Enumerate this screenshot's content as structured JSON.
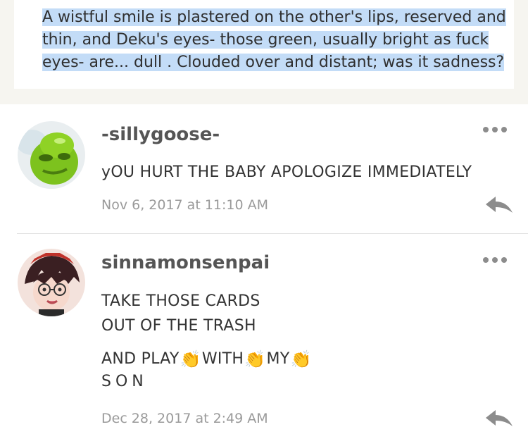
{
  "quote": {
    "text": "A wistful smile is plastered on the other's lips, reserved and thin, and Deku's eyes- those green, usually bright as fuck eyes- are... dull . Clouded over and distant; was it sadness?"
  },
  "comments": [
    {
      "username": "-sillygoose-",
      "avatar": "green-blob-avatar",
      "text": "yOU HURT THE BABY APOLOGIZE IMMEDIATELY",
      "timestamp": "Nov 6, 2017 at 11:10 AM"
    },
    {
      "username": "sinnamonsenpai",
      "avatar": "anime-character-avatar",
      "line1": "TAKE THOSE CARDS",
      "line2": "OUT OF THE TRASH",
      "line3_parts": [
        "AND PLAY",
        "WITH",
        "MY"
      ],
      "clap": "👏",
      "line4": "SON",
      "timestamp": "Dec 28, 2017 at 2:49 AM"
    }
  ],
  "icons": {
    "more": "more-options-icon",
    "reply": "reply-arrow-icon"
  },
  "colors": {
    "highlight": "#c3dcf7",
    "username": "#555555",
    "timestamp": "#9a9a9a",
    "icon": "#8c8c8c"
  }
}
